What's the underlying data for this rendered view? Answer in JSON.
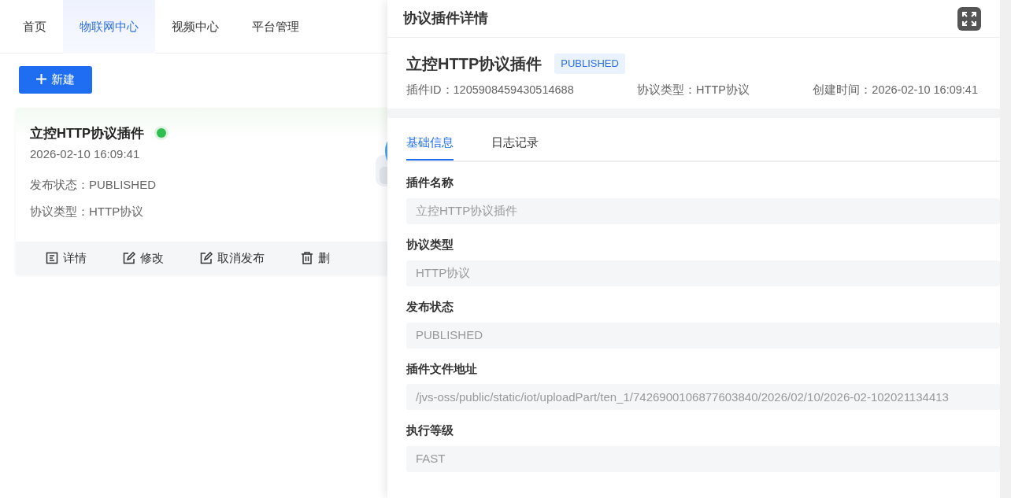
{
  "nav": {
    "items": [
      {
        "label": "首页",
        "selected": false
      },
      {
        "label": "物联网中心",
        "selected": true
      },
      {
        "label": "视频中心",
        "selected": false
      },
      {
        "label": "平台管理",
        "selected": false
      }
    ]
  },
  "new_button": "新建",
  "card": {
    "title": "立控HTTP协议插件",
    "active": true,
    "time": "2026-02-10 16:09:41",
    "lines": [
      "发布状态：PUBLISHED",
      "协议类型：HTTP协议"
    ],
    "actions": [
      {
        "kind": "detail",
        "label": "详情"
      },
      {
        "kind": "edit",
        "label": "修改"
      },
      {
        "kind": "edit",
        "label": "取消发布"
      },
      {
        "kind": "delete",
        "label": "删"
      }
    ]
  },
  "drawer": {
    "title": "协议插件详情",
    "name": "立控HTTP协议插件",
    "badge": "PUBLISHED",
    "meta": [
      "插件ID：1205908459430514688",
      "协议类型：HTTP协议",
      "创建时间：2026-02-10 16:09:41"
    ],
    "tabs": [
      {
        "label": "基础信息",
        "selected": true
      },
      {
        "label": "日志记录",
        "selected": false
      }
    ],
    "fields": [
      {
        "label": "插件名称",
        "value": "立控HTTP协议插件"
      },
      {
        "label": "协议类型",
        "value": "HTTP协议"
      },
      {
        "label": "发布状态",
        "value": "PUBLISHED"
      },
      {
        "label": "插件文件地址",
        "value": "/jvs-oss/public/static/iot/uploadPart/ten_1/7426900106877603840/2026/02/10/2026-02-102021134413"
      },
      {
        "label": "执行等级",
        "value": "FAST"
      }
    ]
  }
}
